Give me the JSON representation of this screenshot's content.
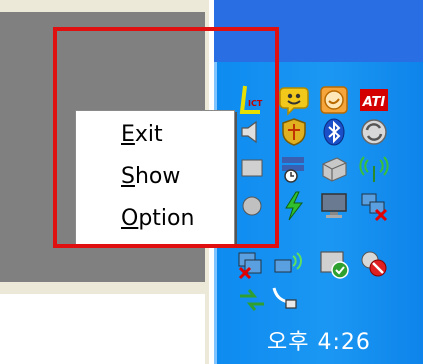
{
  "menu": {
    "items": [
      {
        "id": "exit",
        "mnemonic": "E",
        "rest": "xit"
      },
      {
        "id": "show",
        "mnemonic": "S",
        "rest": "how"
      },
      {
        "id": "option",
        "mnemonic": "O",
        "rest": "ption"
      }
    ]
  },
  "tray": {
    "clock": "오후 4:26",
    "ati_label": "ATI",
    "ict_label": "ICT"
  },
  "colors": {
    "highlight": "#e01010",
    "taskbar_top": "#2a6ee4",
    "tray": "#1b97f3"
  }
}
